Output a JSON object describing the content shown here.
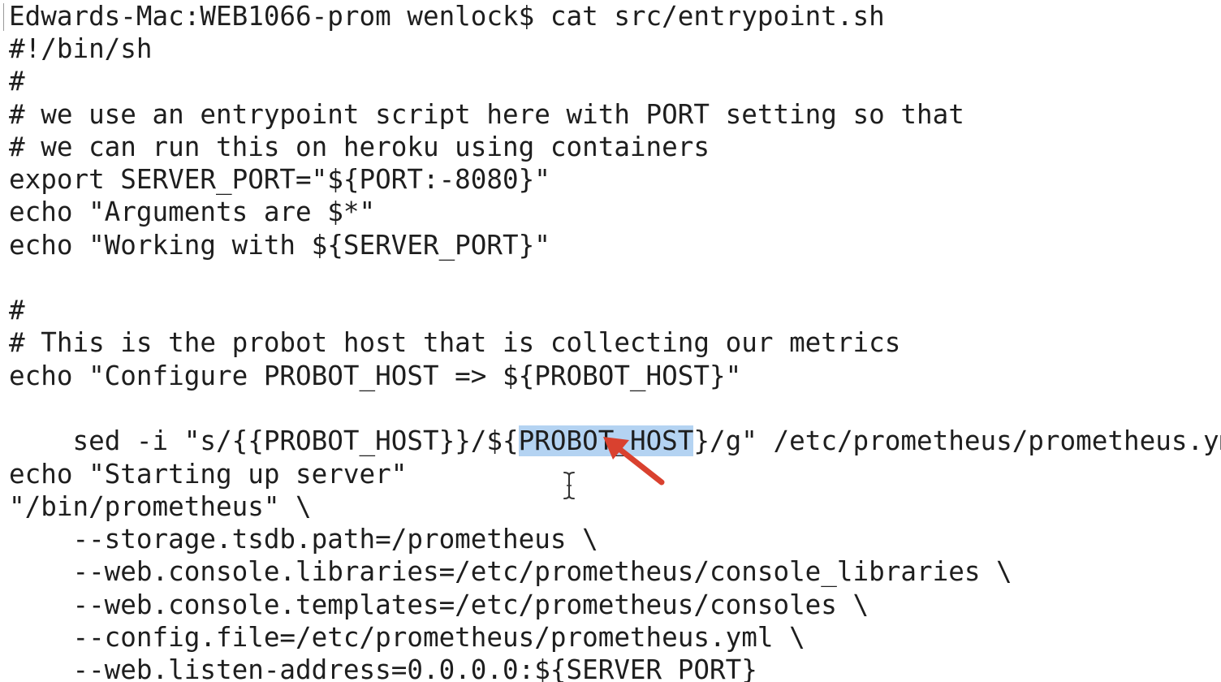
{
  "terminal": {
    "lines": [
      "Edwards-Mac:WEB1066-prom wenlock$ cat src/entrypoint.sh",
      "#!/bin/sh",
      "#",
      "# we use an entrypoint script here with PORT setting so that",
      "# we can run this on heroku using containers",
      "export SERVER_PORT=\"${PORT:-8080}\"",
      "echo \"Arguments are $*\"",
      "echo \"Working with ${SERVER_PORT}\"",
      "",
      "#",
      "# This is the probot host that is collecting our metrics",
      "echo \"Configure PROBOT_HOST => ${PROBOT_HOST}\"",
      "",
      "",
      "echo \"Starting up server\"",
      "\"/bin/prometheus\" \\",
      "    --storage.tsdb.path=/prometheus \\",
      "    --web.console.libraries=/etc/prometheus/console_libraries \\",
      "    --web.console.templates=/etc/prometheus/consoles \\",
      "    --config.file=/etc/prometheus/prometheus.yml \\",
      "    --web.listen-address=0.0.0.0:${SERVER_PORT}"
    ],
    "sed_line": {
      "before": "sed -i \"s/{{PROBOT_HOST}}/${",
      "selected": "PROBOT_HOST",
      "after": "}/g\" /etc/prometheus/prometheus.yml"
    },
    "annotation": {
      "arrow_color": "#d9412f",
      "selection_color": "#b4d3f2",
      "cursor_icon": "ibeam-cursor-icon"
    }
  }
}
